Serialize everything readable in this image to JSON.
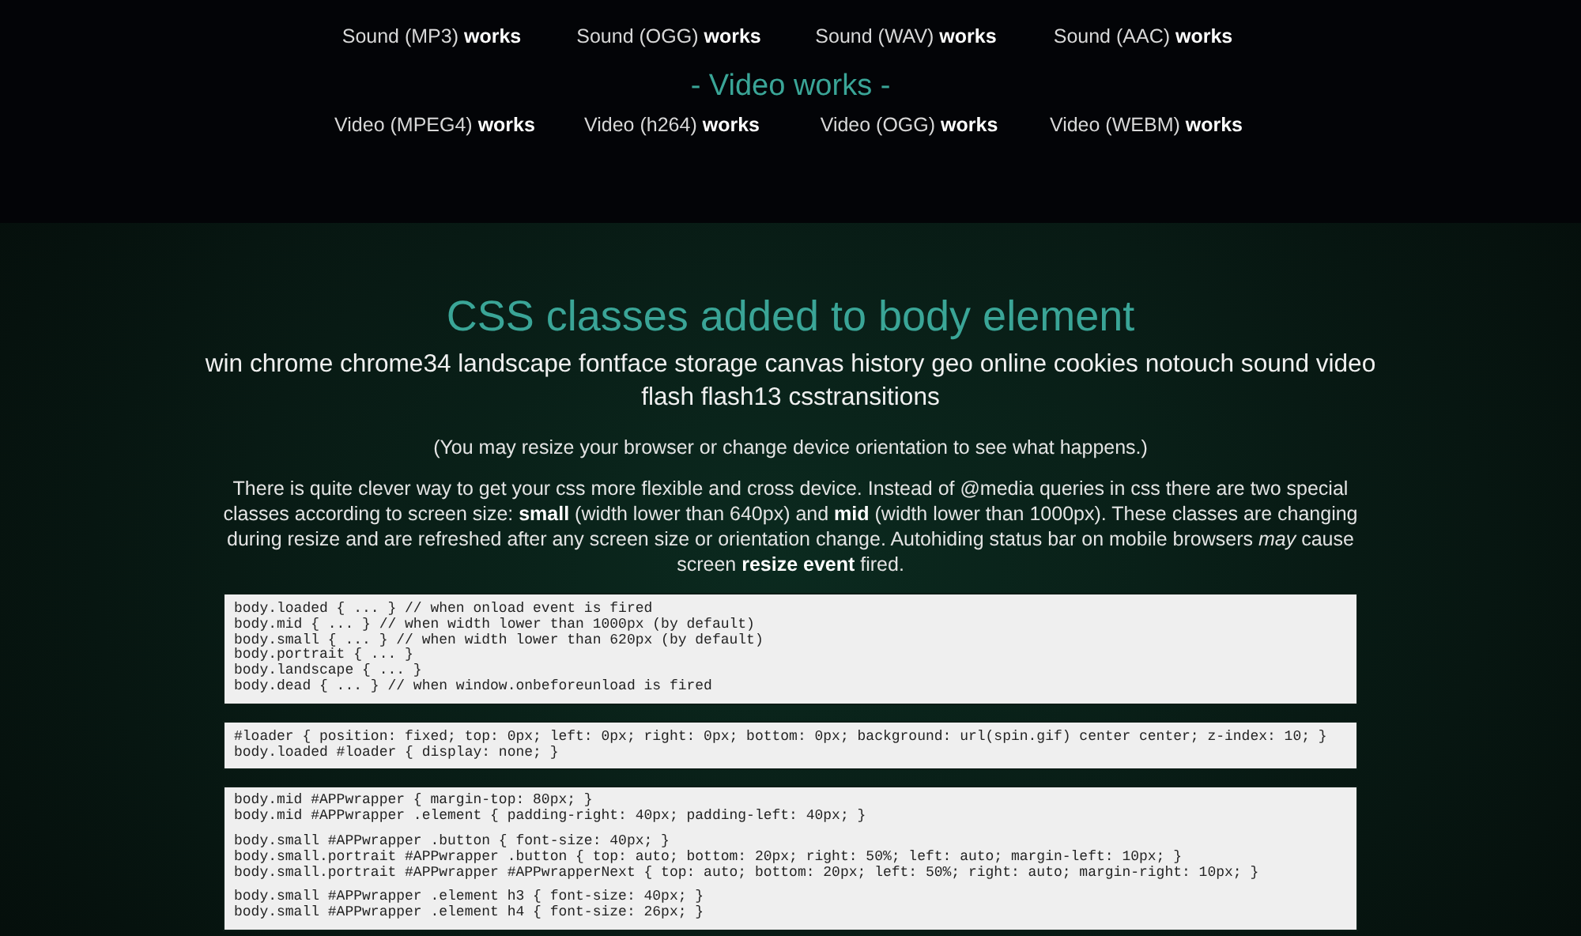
{
  "sound_tests": [
    "Sound (MP3) **works**",
    "Sound (OGG) **works**",
    "Sound (WAV) **works**",
    "Sound (AAC) **works**"
  ],
  "video_heading": "- Video works -",
  "video_tests": [
    "Video (MPEG4) **works**",
    "Video (h264) **works**",
    "Video (OGG) **works**",
    "Video (WEBM) **works**"
  ],
  "heading": "CSS classes added to body element",
  "body_classes": "win chrome chrome34 landscape fontface storage canvas history geo online cookies notouch sound video flash flash13 csstransitions",
  "resize_note": "(You may resize your browser or change device orientation to see what happens.)",
  "description": "There is quite clever way to get your css more flexible and cross device. Instead of @media queries in css there are two special classes according to screen size: **small** (width lower than 640px) and **mid** (width lower than 1000px). These classes are changing during resize and are refreshed after any screen size or orientation change. Autohiding status bar on mobile browsers *may* cause screen **resize event** fired.",
  "code_blocks": [
    {
      "groups": [
        [
          "body.loaded { ... } // when onload event is fired",
          "body.mid { ... } // when width lower than 1000px (by default)",
          "body.small { ... } // when width lower than 620px (by default)",
          "body.portrait { ... }",
          "body.landscape { ... }",
          "body.dead { ... } // when window.onbeforeunload is fired"
        ]
      ]
    },
    {
      "groups": [
        [
          "#loader { position: fixed; top: 0px; left: 0px; right: 0px; bottom: 0px; background: url(spin.gif) center center; z-index: 10; }",
          "body.loaded #loader { display: none; }"
        ]
      ]
    },
    {
      "groups": [
        [
          "body.mid #APPwrapper { margin-top: 80px; }",
          "body.mid #APPwrapper .element { padding-right: 40px; padding-left: 40px; }"
        ],
        [
          "body.small #APPwrapper .button { font-size: 40px; }",
          "body.small.portrait #APPwrapper .button { top: auto; bottom: 20px; right: 50%; left: auto; margin-left: 10px; }",
          "body.small.portrait #APPwrapper #APPwrapperNext { top: auto; bottom: 20px; left: 50%; right: auto; margin-right: 10px; }"
        ],
        [
          "body.small #APPwrapper .element h3 { font-size: 40px; }",
          "body.small #APPwrapper .element h4 { font-size: 26px; }"
        ]
      ]
    }
  ]
}
